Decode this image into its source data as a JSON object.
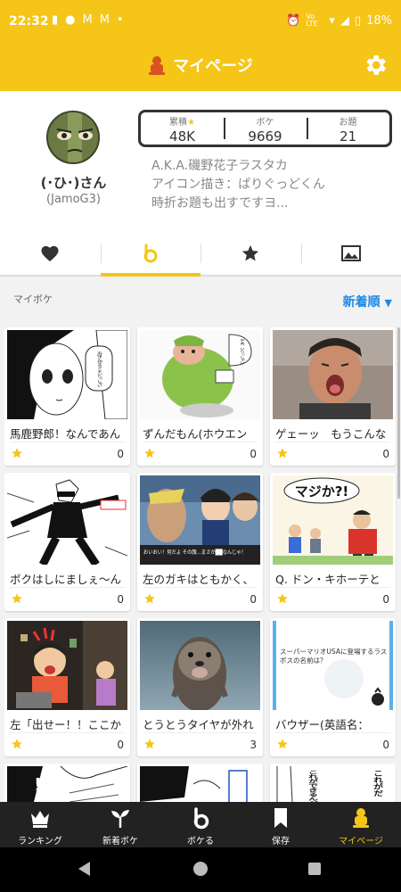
{
  "status_bar": {
    "time": "22:32",
    "battery": "18%",
    "network": "Vo LTE"
  },
  "header": {
    "title": "マイページ"
  },
  "profile": {
    "username": "(･ひ･)さん",
    "user_id": "(JamoG3)",
    "stats": [
      {
        "label": "累積",
        "value": "48K"
      },
      {
        "label": "ボケ",
        "value": "9669"
      },
      {
        "label": "お題",
        "value": "21"
      }
    ],
    "bio": [
      "A.K.A.磯野花子ラスタカ",
      "アイコン描き：ばりぐっどくん",
      "時折お題も出すですヨ..."
    ]
  },
  "tabs": [
    "heart-tab",
    "boke-tab",
    "star-tab",
    "image-tab"
  ],
  "section": {
    "title": "マイボケ",
    "sort_label": "新着順"
  },
  "cards": [
    {
      "caption": "馬鹿野郎！なんであん",
      "count": "0",
      "image": "manga-girl"
    },
    {
      "caption": "ずんだもん(ホウエン",
      "count": "0",
      "image": "manga-green-cap"
    },
    {
      "caption": "ゲェーッ　もうこんな",
      "count": "0",
      "image": "photo-man-shouting"
    },
    {
      "caption": "ボクはしにましぇ～ん",
      "count": "0",
      "image": "manga-posing-man"
    },
    {
      "caption": "左のガキはともかく、",
      "count": "0",
      "image": "anime-detective"
    },
    {
      "caption": "Q. ドン・キホーテと",
      "count": "0",
      "image": "illustration-majika"
    },
    {
      "caption": "左「出せー！！ここか",
      "count": "0",
      "image": "illustration-angry-gamer"
    },
    {
      "caption": "とうとうタイヤが外れ",
      "count": "3",
      "image": "photo-otter"
    },
    {
      "caption": "バウザー(英語名：",
      "count": "0",
      "image": "text-mario-question"
    },
    {
      "caption": "",
      "count": "",
      "image": "manga-partial-1"
    },
    {
      "caption": "",
      "count": "",
      "image": "manga-partial-2"
    },
    {
      "caption": "",
      "count": "",
      "image": "manga-partial-3"
    }
  ],
  "image_texts": {
    "card1": "おばさんがようこそいらっしゃい",
    "card2": "やあ、いらっしゃい",
    "card5": "おいおい！何だよ その顔…まさか██なんじゃ！",
    "card6": "マジか?!",
    "card9": "スーパーマリオUSAに登場するラスボスの名前は？",
    "card12a": "これができるんだ",
    "card12b": "これがだ"
  },
  "bottom_nav": [
    {
      "label": "ランキング",
      "icon": "crown-icon"
    },
    {
      "label": "新着ボケ",
      "icon": "sprout-icon"
    },
    {
      "label": "ボケる",
      "icon": "boke-b-icon"
    },
    {
      "label": "保存",
      "icon": "bookmark-icon"
    },
    {
      "label": "マイページ",
      "icon": "mypage-person-icon",
      "active": true
    }
  ],
  "colors": {
    "brand": "#f5c518",
    "sort": "#1e88e5",
    "nav_bg": "#222222"
  }
}
